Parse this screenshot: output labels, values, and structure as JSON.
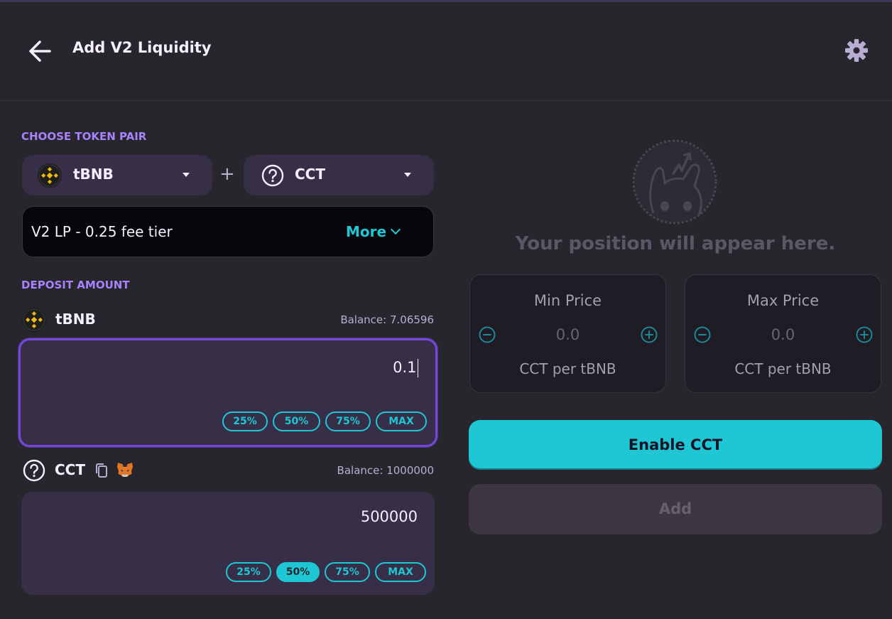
{
  "header": {
    "title": "Add V2 Liquidity",
    "back_icon": "arrow-left-icon",
    "settings_icon": "gear-icon"
  },
  "token_pair": {
    "label": "CHOOSE TOKEN PAIR",
    "token_a": {
      "symbol": "tBNB",
      "icon": "bnb-icon"
    },
    "plus": "+",
    "token_b": {
      "symbol": "CCT",
      "icon": "help-circle-icon"
    }
  },
  "fee_tier": {
    "text": "V2 LP - 0.25 fee tier",
    "more_label": "More"
  },
  "deposit": {
    "label": "DEPOSIT AMOUNT",
    "token_a": {
      "symbol": "tBNB",
      "balance": "Balance: 7.06596",
      "amount": "0.1",
      "percent_buttons": [
        "25%",
        "50%",
        "75%",
        "MAX"
      ]
    },
    "token_b": {
      "symbol": "CCT",
      "balance": "Balance: 1000000",
      "amount": "500000",
      "percent_buttons": [
        "25%",
        "50%",
        "75%",
        "MAX"
      ],
      "active_percent": "50%"
    }
  },
  "position": {
    "empty_message": "Your position will appear here.",
    "min_price": {
      "title": "Min Price",
      "value": "0.0",
      "unit": "CCT per tBNB"
    },
    "max_price": {
      "title": "Max Price",
      "value": "0.0",
      "unit": "CCT per tBNB"
    }
  },
  "actions": {
    "enable_label": "Enable CCT",
    "add_label": "Add"
  },
  "colors": {
    "accent": "#1fc7d4",
    "secondary": "#a881fc",
    "focus": "#7645d9",
    "background": "#27262c"
  }
}
